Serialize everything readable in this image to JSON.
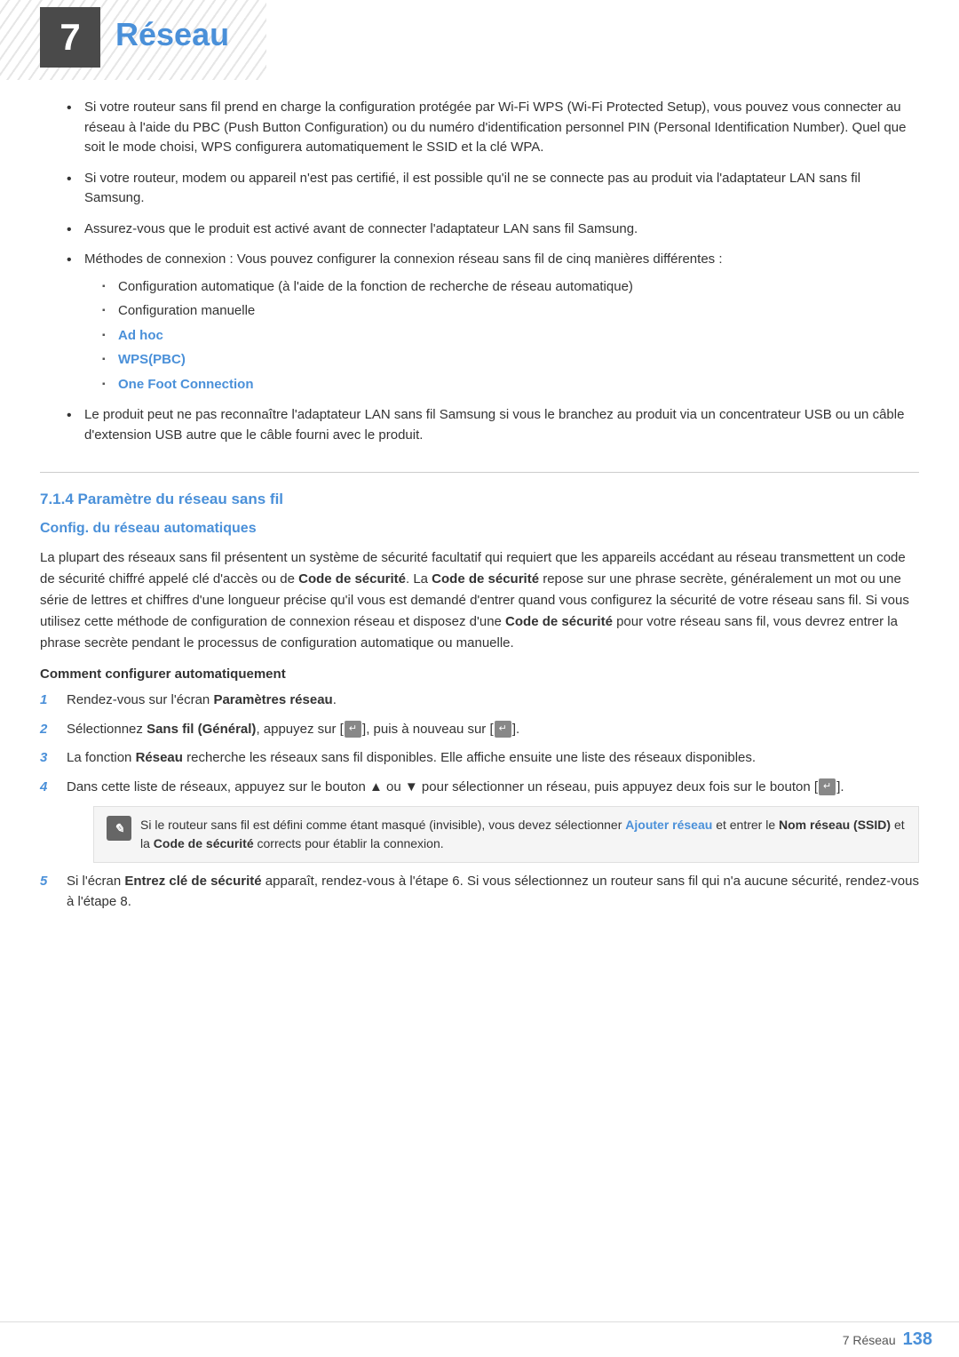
{
  "chapter": {
    "number": "7",
    "title": "Réseau",
    "title_color": "#4a90d9"
  },
  "bullets": [
    {
      "id": "bullet1",
      "text": "Si votre routeur sans fil prend en charge la configuration protégée par Wi-Fi WPS (Wi-Fi Protected Setup), vous pouvez vous connecter au réseau à l'aide du PBC (Push Button Configuration) ou du numéro d'identification personnel PIN (Personal Identification Number). Quel que soit le mode choisi, WPS configurera automatiquement le SSID et la clé WPA."
    },
    {
      "id": "bullet2",
      "text": "Si votre routeur, modem ou appareil n'est pas certifié, il est possible qu'il ne se connecte pas au produit via l'adaptateur LAN sans fil Samsung."
    },
    {
      "id": "bullet3",
      "text": "Assurez-vous que le produit est activé avant de connecter l'adaptateur LAN sans fil Samsung."
    },
    {
      "id": "bullet4",
      "text": "Méthodes de connexion : Vous pouvez configurer la connexion réseau sans fil de cinq manières différentes :",
      "subitems": [
        {
          "id": "sub1",
          "text": "Configuration automatique (à l'aide de la fonction de recherche de réseau automatique)",
          "highlight": false
        },
        {
          "id": "sub2",
          "text": "Configuration manuelle",
          "highlight": false
        },
        {
          "id": "sub3",
          "text": "Ad hoc",
          "highlight": true
        },
        {
          "id": "sub4",
          "text": "WPS(PBC)",
          "highlight": true
        },
        {
          "id": "sub5",
          "text": "One Foot Connection",
          "highlight": true
        }
      ]
    },
    {
      "id": "bullet5",
      "text": "Le produit peut ne pas reconnaître l'adaptateur LAN sans fil Samsung si vous le branchez au produit via un concentrateur USB ou un câble d'extension USB autre que le câble fourni avec le produit."
    }
  ],
  "section714": {
    "heading": "7.1.4   Paramètre du réseau sans fil",
    "subheading": "Config. du réseau automatiques",
    "paragraph1": "La plupart des réseaux sans fil présentent un système de sécurité facultatif qui requiert que les appareils accédant au réseau transmettent un code de sécurité chiffré appelé clé d'accès ou de ",
    "bold1": "Code de sécurité",
    "paragraph1b": ". La ",
    "bold2": "Code de sécurité",
    "paragraph1c": " repose sur une phrase secrète, généralement un mot ou une série de lettres et chiffres d'une longueur précise qu'il vous est demandé d'entrer quand vous configurez la sécurité de votre réseau sans fil. Si vous utilisez cette méthode de configuration de connexion réseau et disposez d'une ",
    "bold3": "Code de sécurité",
    "paragraph1d": " pour votre réseau sans fil, vous devrez entrer la phrase secrète pendant le processus de configuration automatique ou manuelle.",
    "sub_subheading": "Comment configurer automatiquement",
    "steps": [
      {
        "number": "1",
        "text": "Rendez-vous sur l'écran ",
        "bold": "Paramètres réseau",
        "textAfter": "."
      },
      {
        "number": "2",
        "text": "Sélectionnez ",
        "bold": "Sans fil (Général)",
        "textAfter": ", appuyez sur [↵], puis à nouveau sur [↵]."
      },
      {
        "number": "3",
        "text": "La fonction ",
        "bold": "Réseau",
        "textAfter": " recherche les réseaux sans fil disponibles. Elle affiche ensuite une liste des réseaux disponibles."
      },
      {
        "number": "4",
        "text": "Dans cette liste de réseaux, appuyez sur le bouton ▲ ou ▼ pour sélectionner un réseau, puis appuyez deux fois sur le bouton [↵].",
        "hasNote": true,
        "noteText": "Si le routeur sans fil est défini comme étant masqué (invisible), vous devez sélectionner ",
        "noteBold1": "Ajouter réseau",
        "noteText2": " et entrer le ",
        "noteBold2": "Nom réseau (SSID)",
        "noteText3": " et la ",
        "noteBold3": "Code de sécurité",
        "noteText4": " corrects pour établir la connexion."
      },
      {
        "number": "5",
        "text": "Si l'écran ",
        "bold": "Entrez clé de sécurité",
        "textAfter": " apparaît, rendez-vous à l'étape 6. Si vous sélectionnez un routeur sans fil qui n'a aucune sécurité, rendez-vous à l'étape 8."
      }
    ]
  },
  "footer": {
    "text": "7 Réseau",
    "page": "138"
  }
}
